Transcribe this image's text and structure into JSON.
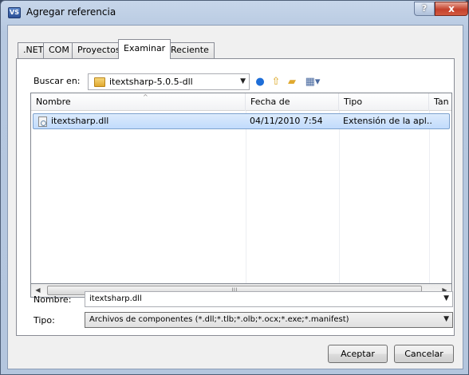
{
  "window": {
    "title": "Agregar referencia",
    "help_symbol": "?",
    "close_symbol": "x"
  },
  "tabs": [
    {
      "label": ".NET",
      "active": false
    },
    {
      "label": "COM",
      "active": false
    },
    {
      "label": "Proyectos",
      "active": false
    },
    {
      "label": "Examinar",
      "active": true
    },
    {
      "label": "Reciente",
      "active": false
    }
  ],
  "lookin": {
    "label": "Buscar en:",
    "value": "itextsharp-5.0.5-dll"
  },
  "toolbar_icons": [
    "back-icon",
    "up-folder-icon",
    "new-folder-icon",
    "view-menu-icon"
  ],
  "list": {
    "columns": [
      "Nombre",
      "Fecha de modifica...",
      "Tipo",
      "Tan"
    ],
    "rows": [
      {
        "name": "itextsharp.dll",
        "date": "04/11/2010 7:54",
        "type": "Extensión de la apl...",
        "selected": true
      }
    ]
  },
  "filename": {
    "label": "Nombre:",
    "value": "itextsharp.dll"
  },
  "filetype": {
    "label": "Tipo:",
    "value": "Archivos de componentes (*.dll;*.tlb;*.olb;*.ocx;*.exe;*.manifest)"
  },
  "buttons": {
    "accept": "Aceptar",
    "cancel": "Cancelar"
  },
  "colors": {
    "selection": "#c1dbfc",
    "close_button": "#c4412c"
  }
}
